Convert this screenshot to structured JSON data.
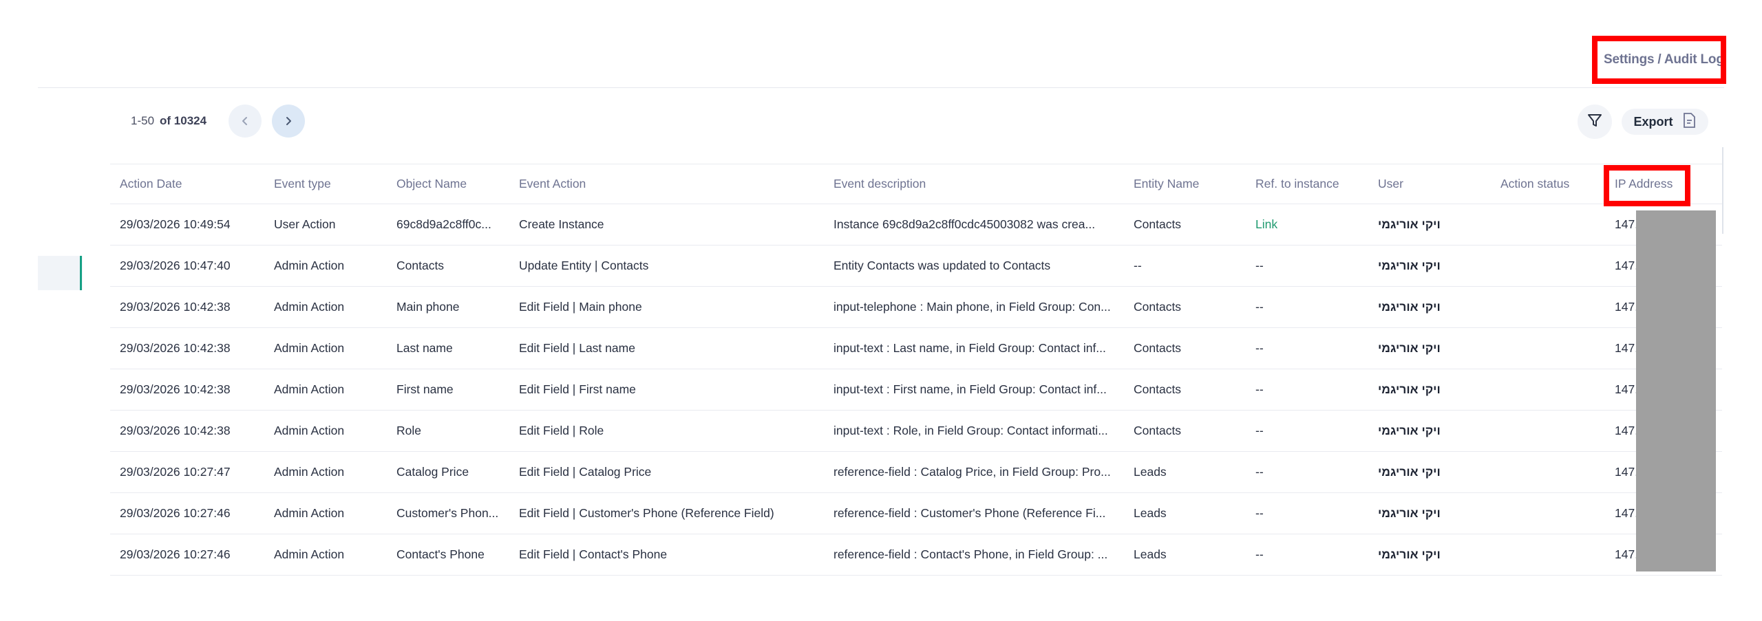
{
  "breadcrumb": "Settings / Audit Log",
  "pagination": {
    "range": "1-50",
    "of_label": "of 10324"
  },
  "toolbar": {
    "export_label": "Export"
  },
  "columns": [
    "Action Date",
    "Event type",
    "Object Name",
    "Event Action",
    "Event description",
    "Entity Name",
    "Ref. to instance",
    "User",
    "Action status",
    "IP Address"
  ],
  "rows": [
    {
      "date": "29/03/2026 10:49:54",
      "type": "User Action",
      "object": "69c8d9a2c8ff0c...",
      "action": "Create Instance",
      "desc": "Instance 69c8d9a2c8ff0cdc45003082 was crea...",
      "entity": "Contacts",
      "ref": "Link",
      "user": "ויקי אוריגמי",
      "status": "",
      "ip": "147."
    },
    {
      "date": "29/03/2026 10:47:40",
      "type": "Admin Action",
      "object": "Contacts",
      "action": "Update Entity | Contacts",
      "desc": "Entity Contacts was updated to Contacts",
      "entity": "--",
      "ref": "--",
      "user": "ויקי אוריגמי",
      "status": "",
      "ip": "147."
    },
    {
      "date": "29/03/2026 10:42:38",
      "type": "Admin Action",
      "object": "Main phone",
      "action": "Edit Field | Main phone",
      "desc": "input-telephone : Main phone, in Field Group: Con...",
      "entity": "Contacts",
      "ref": "--",
      "user": "ויקי אוריגמי",
      "status": "",
      "ip": "147."
    },
    {
      "date": "29/03/2026 10:42:38",
      "type": "Admin Action",
      "object": "Last name",
      "action": "Edit Field | Last name",
      "desc": "input-text : Last name, in Field Group: Contact inf...",
      "entity": "Contacts",
      "ref": "--",
      "user": "ויקי אוריגמי",
      "status": "",
      "ip": "147."
    },
    {
      "date": "29/03/2026 10:42:38",
      "type": "Admin Action",
      "object": "First name",
      "action": "Edit Field | First name",
      "desc": "input-text : First name, in Field Group: Contact inf...",
      "entity": "Contacts",
      "ref": "--",
      "user": "ויקי אוריגמי",
      "status": "",
      "ip": "147."
    },
    {
      "date": "29/03/2026 10:42:38",
      "type": "Admin Action",
      "object": "Role",
      "action": "Edit Field | Role",
      "desc": "input-text : Role, in Field Group: Contact informati...",
      "entity": "Contacts",
      "ref": "--",
      "user": "ויקי אוריגמי",
      "status": "",
      "ip": "147."
    },
    {
      "date": "29/03/2026 10:27:47",
      "type": "Admin Action",
      "object": "Catalog Price",
      "action": "Edit Field | Catalog Price",
      "desc": "reference-field : Catalog Price, in Field Group: Pro...",
      "entity": "Leads",
      "ref": "--",
      "user": "ויקי אוריגמי",
      "status": "",
      "ip": "147."
    },
    {
      "date": "29/03/2026 10:27:46",
      "type": "Admin Action",
      "object": "Customer's Phon...",
      "action": "Edit Field | Customer's Phone (Reference Field)",
      "desc": "reference-field : Customer's Phone (Reference Fi...",
      "entity": "Leads",
      "ref": "--",
      "user": "ויקי אוריגמי",
      "status": "",
      "ip": "147."
    },
    {
      "date": "29/03/2026 10:27:46",
      "type": "Admin Action",
      "object": "Contact's Phone",
      "action": "Edit Field | Contact's Phone",
      "desc": "reference-field : Contact's Phone, in Field Group: ...",
      "entity": "Leads",
      "ref": "--",
      "user": "ויקי אוריגמי",
      "status": "",
      "ip": "147."
    }
  ],
  "colors": {
    "accent": "#16a085",
    "link": "#1f9a6f",
    "highlight": "#ff0000",
    "redaction": "#a0a0a0"
  },
  "icons": {
    "prev": "chevron-left-icon",
    "next": "chevron-right-icon",
    "filter": "filter-icon",
    "export": "export-file-icon"
  }
}
